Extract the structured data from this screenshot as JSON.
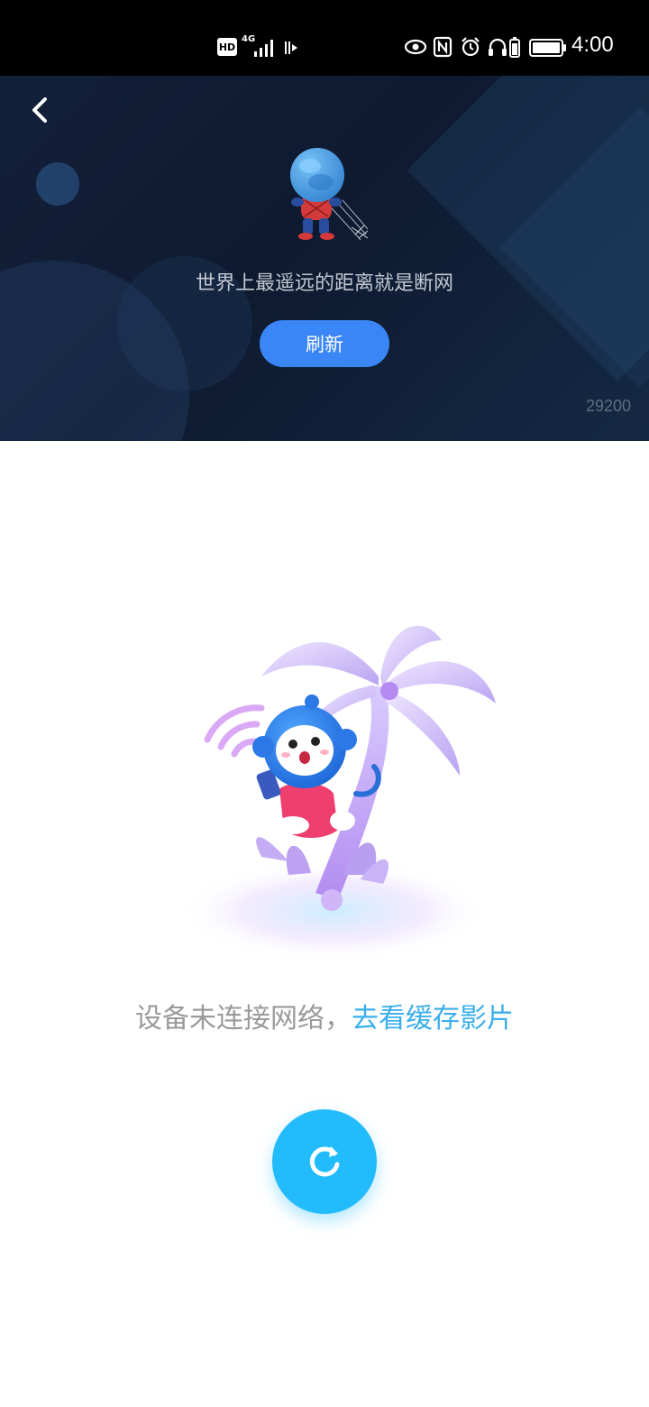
{
  "status_bar": {
    "hd_label": "HD",
    "network_label": "4G",
    "time": "4:00",
    "icons": [
      "signal-icon",
      "data-icon",
      "eye-icon",
      "nfc-icon",
      "alarm-icon",
      "headphones-icon",
      "battery-icon"
    ]
  },
  "banner": {
    "message": "世界上最遥远的距离就是断网",
    "refresh_label": "刷新",
    "code": "29200",
    "back_icon": "chevron-left-icon"
  },
  "main": {
    "offline_text": "设备未连接网络，",
    "cache_link": "去看缓存影片",
    "reload_icon": "refresh-icon"
  },
  "colors": {
    "banner_bg": "#0e1a30",
    "refresh_button": "#3a86f6",
    "link": "#3aaeea",
    "reload_button": "#22bbfb"
  }
}
